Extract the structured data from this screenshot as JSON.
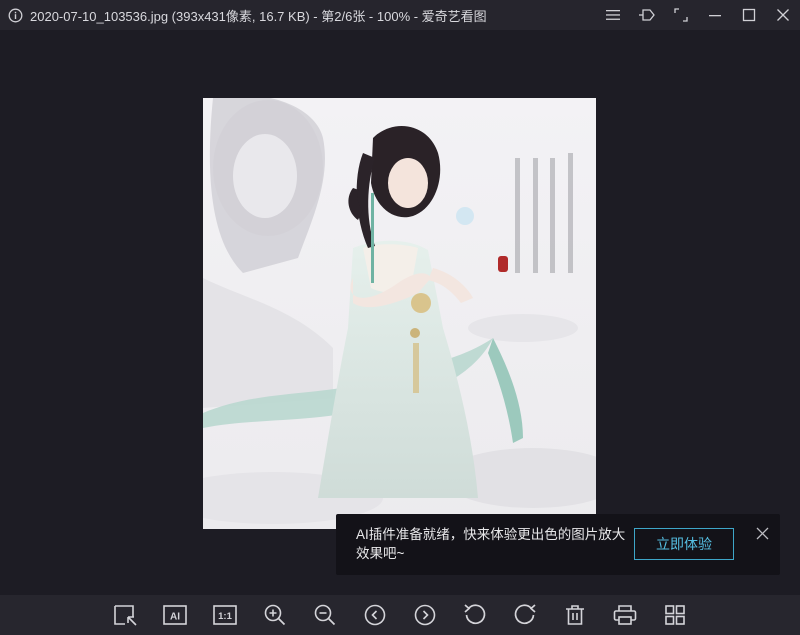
{
  "window": {
    "title": "2020-07-10_103536.jpg (393x431像素, 16.7 KB) - 第2/6张 - 100% - 爱奇艺看图"
  },
  "toolbar": {
    "tools": [
      {
        "name": "crop-select-icon"
      },
      {
        "name": "ai-icon",
        "label": "AI"
      },
      {
        "name": "actual-size-icon",
        "label": "1:1"
      },
      {
        "name": "zoom-in-icon"
      },
      {
        "name": "zoom-out-icon"
      },
      {
        "name": "previous-icon"
      },
      {
        "name": "next-icon"
      },
      {
        "name": "rotate-left-icon"
      },
      {
        "name": "rotate-right-icon"
      },
      {
        "name": "delete-icon"
      },
      {
        "name": "print-icon"
      },
      {
        "name": "grid-view-icon"
      }
    ]
  },
  "toast": {
    "message": "AI插件准备就绪，快来体验更出色的图片放大效果吧~",
    "button_label": "立即体验"
  },
  "colors": {
    "background": "#1d1c24",
    "titlebar": "#26252d",
    "toolbar": "#27262e",
    "accent": "#3ea6c8"
  }
}
